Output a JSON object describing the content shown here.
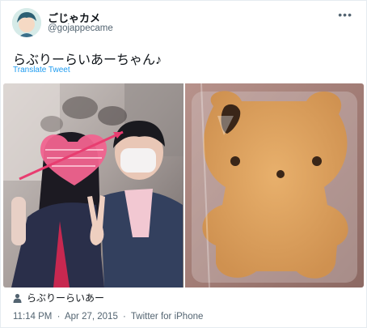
{
  "user": {
    "display_name": "ごじゃカメ",
    "handle": "@gojappecame"
  },
  "tweet": {
    "text": "らぶりーらいあーちゃん♪",
    "translate_label": "Translate Tweet"
  },
  "media": {
    "tagged_user": "らぶりーらいあー"
  },
  "meta": {
    "time": "11:14 PM",
    "separator": "·",
    "date": "Apr 27, 2015",
    "source": "Twitter for iPhone"
  },
  "colors": {
    "link": "#1d9bf0",
    "secondary_text": "#536471",
    "border": "#e6ecf0"
  },
  "icons": {
    "more": "more-options-icon",
    "tag": "person-tag-icon"
  }
}
